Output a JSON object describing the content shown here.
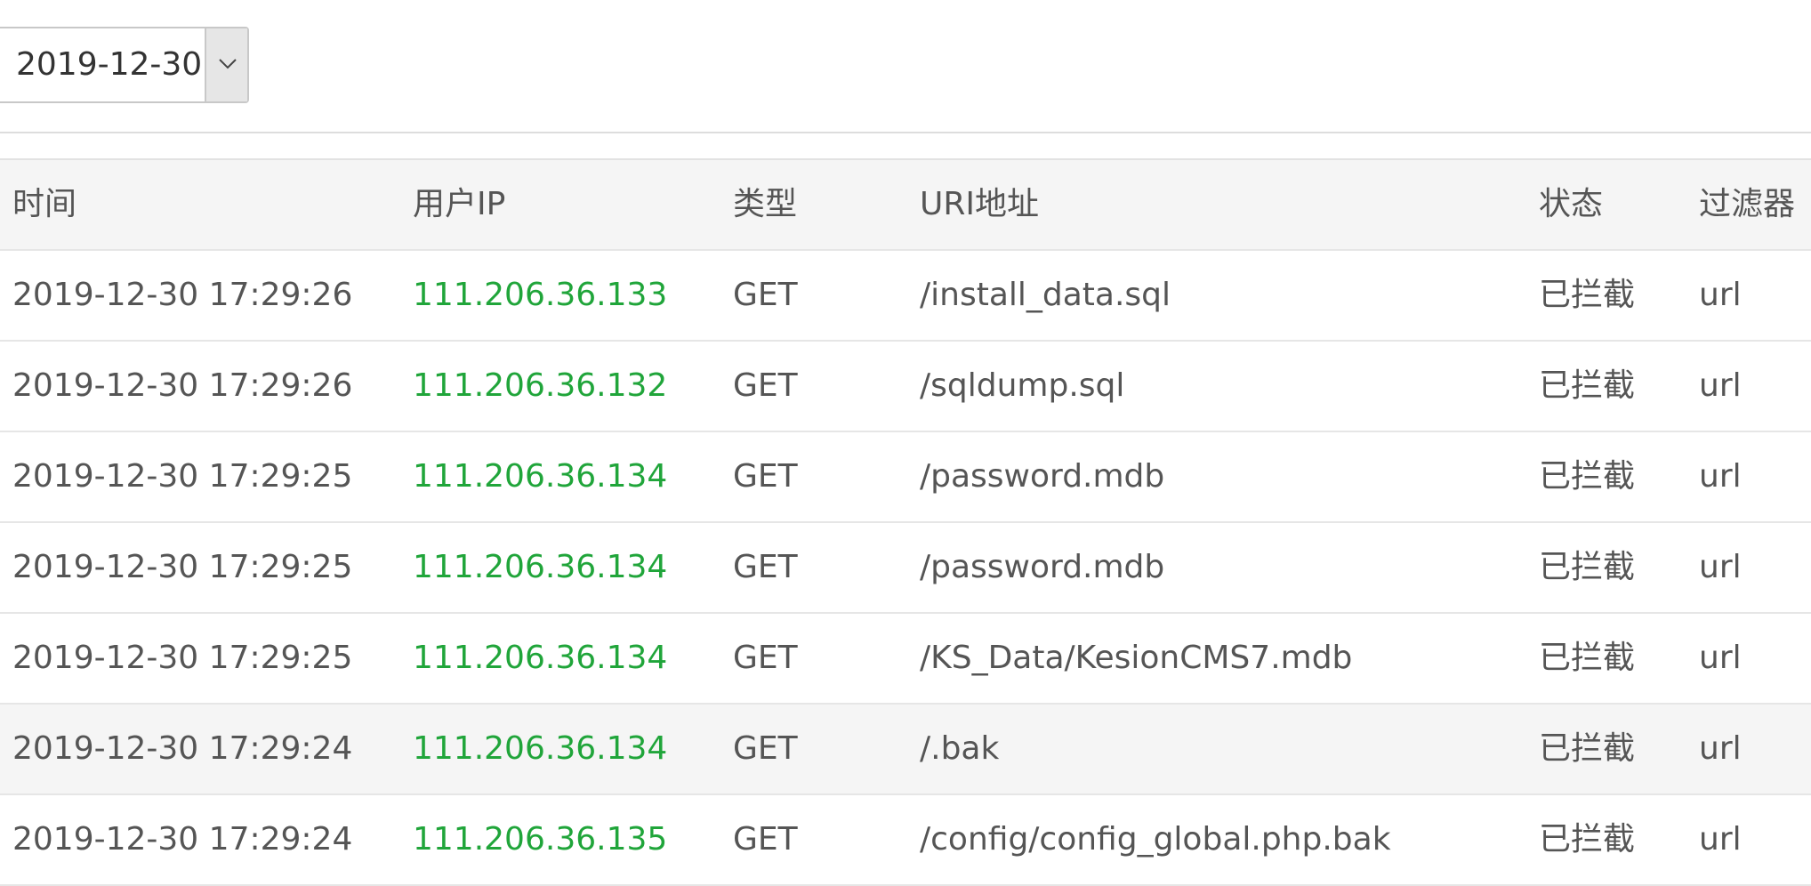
{
  "date_filter": {
    "selected": "2019-12-30",
    "arrow_icon": "chevron-down-icon"
  },
  "colors": {
    "ip": "#20a53a",
    "text": "#555555",
    "header_bg": "#f5f5f5"
  },
  "table": {
    "columns": [
      "时间",
      "用户IP",
      "类型",
      "URI地址",
      "状态",
      "过滤器"
    ],
    "rows": [
      {
        "time": "2019-12-30 17:29:26",
        "ip": "111.206.36.133",
        "type": "GET",
        "uri": "/install_data.sql",
        "status": "已拦截",
        "filter": "url"
      },
      {
        "time": "2019-12-30 17:29:26",
        "ip": "111.206.36.132",
        "type": "GET",
        "uri": "/sqldump.sql",
        "status": "已拦截",
        "filter": "url"
      },
      {
        "time": "2019-12-30 17:29:25",
        "ip": "111.206.36.134",
        "type": "GET",
        "uri": "/password.mdb",
        "status": "已拦截",
        "filter": "url"
      },
      {
        "time": "2019-12-30 17:29:25",
        "ip": "111.206.36.134",
        "type": "GET",
        "uri": "/password.mdb",
        "status": "已拦截",
        "filter": "url"
      },
      {
        "time": "2019-12-30 17:29:25",
        "ip": "111.206.36.134",
        "type": "GET",
        "uri": "/KS_Data/KesionCMS7.mdb",
        "status": "已拦截",
        "filter": "url"
      },
      {
        "time": "2019-12-30 17:29:24",
        "ip": "111.206.36.134",
        "type": "GET",
        "uri": "/.bak",
        "status": "已拦截",
        "filter": "url",
        "highlighted": true
      },
      {
        "time": "2019-12-30 17:29:24",
        "ip": "111.206.36.135",
        "type": "GET",
        "uri": "/config/config_global.php.bak",
        "status": "已拦截",
        "filter": "url"
      }
    ]
  }
}
